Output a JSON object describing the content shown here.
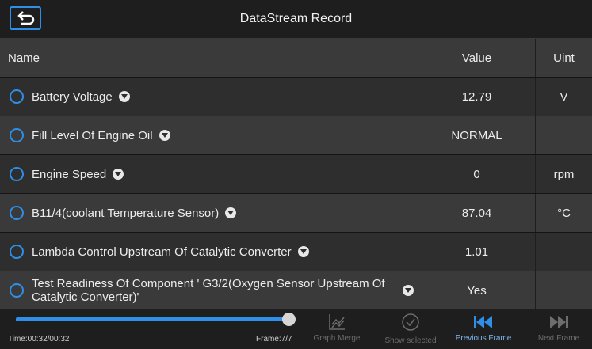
{
  "header": {
    "title": "DataStream Record"
  },
  "table": {
    "columns": {
      "name": "Name",
      "value": "Value",
      "unit": "Uint"
    },
    "rows": [
      {
        "name": "Battery Voltage",
        "value": "12.79",
        "unit": "V"
      },
      {
        "name": "Fill Level Of Engine Oil",
        "value": "NORMAL",
        "unit": ""
      },
      {
        "name": "Engine Speed",
        "value": "0",
        "unit": "rpm"
      },
      {
        "name": "B11/4(coolant Temperature Sensor)",
        "value": "87.04",
        "unit": "°C"
      },
      {
        "name": "Lambda Control Upstream Of Catalytic Converter",
        "value": "1.01",
        "unit": ""
      },
      {
        "name": "Test Readiness Of Component ' G3/2(Oxygen Sensor Upstream Of Catalytic Converter)'",
        "value": "Yes",
        "unit": ""
      }
    ]
  },
  "playback": {
    "time": "Time:00:32/00:32",
    "frame": "Frame:7/7",
    "progress": 1.0
  },
  "toolbar": {
    "graph_merge": "Graph Merge",
    "show_selected": "Show selected",
    "previous_frame": "Previous Frame",
    "next_frame": "Next Frame"
  },
  "colors": {
    "accent": "#2f8fe8",
    "background": "#1b1b1b",
    "row_dark": "#2e2e2e",
    "row_light": "#3a3a3a"
  },
  "icons": {
    "back": "back-arrow-icon",
    "dropdown": "dropdown-circle-icon",
    "graph_merge": "graph-merge-icon",
    "show_selected": "check-circle-icon",
    "previous_frame": "skip-previous-icon",
    "next_frame": "skip-next-icon"
  }
}
